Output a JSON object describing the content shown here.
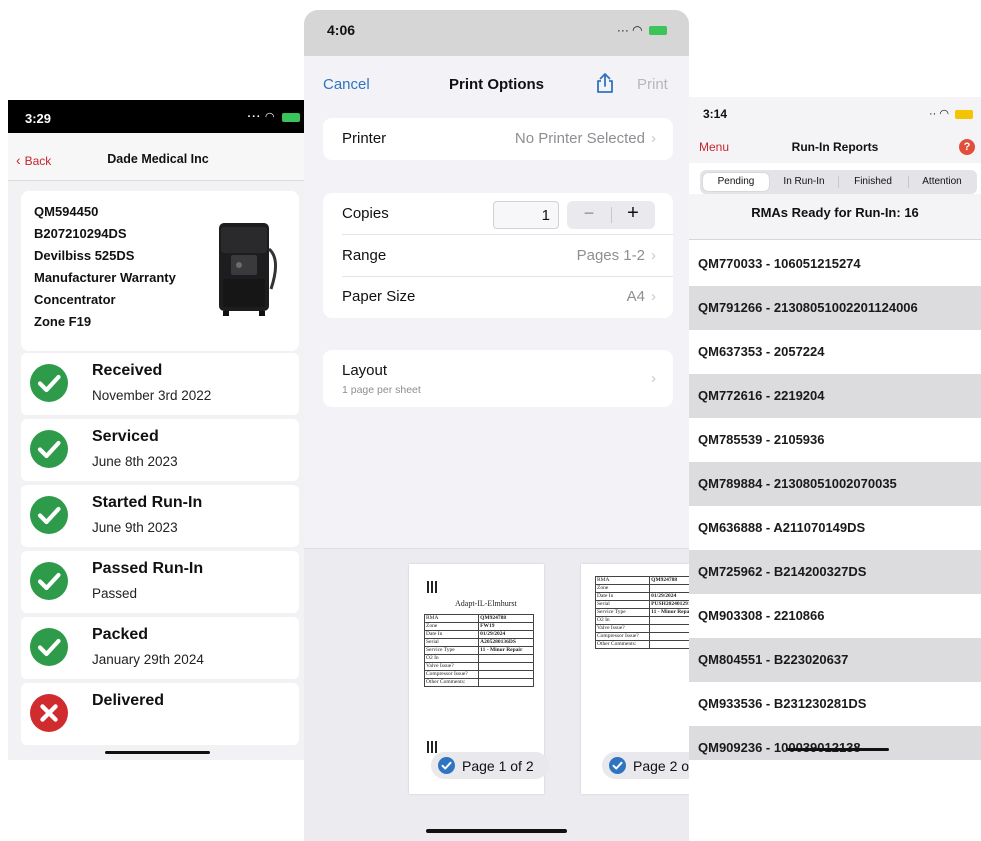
{
  "left": {
    "status_time": "3:29",
    "back_label": "Back",
    "title": "Dade Medical Inc",
    "info_lines": [
      "QM594450",
      "B207210294DS",
      "Devilbiss 525DS",
      "Manufacturer Warranty",
      "Concentrator",
      "Zone F19"
    ],
    "statuses": [
      {
        "label": "Received",
        "sub": "November 3rd 2022",
        "state": "done"
      },
      {
        "label": "Serviced",
        "sub": "June 8th 2023",
        "state": "done"
      },
      {
        "label": "Started Run-In",
        "sub": "June 9th 2023",
        "state": "done"
      },
      {
        "label": "Passed Run-In",
        "sub": "Passed",
        "state": "done"
      },
      {
        "label": "Packed",
        "sub": "January 29th 2024",
        "state": "done"
      },
      {
        "label": "Delivered",
        "sub": "",
        "state": "failed"
      }
    ],
    "colors": {
      "accent": "#c4262e",
      "check_green": "#2e9b4a",
      "fail_red": "#d02b2f"
    }
  },
  "middle": {
    "status_time": "4:06",
    "cancel_label": "Cancel",
    "title": "Print Options",
    "print_label": "Print",
    "printer_label": "Printer",
    "printer_value": "No Printer Selected",
    "copies_label": "Copies",
    "copies_value": "1",
    "range_label": "Range",
    "range_value": "Pages 1-2",
    "paper_label": "Paper Size",
    "paper_value": "A4",
    "layout_label": "Layout",
    "layout_sub": "1 page per sheet",
    "page1_label": "Page 1 of 2",
    "page2_label": "Page 2 o",
    "doc": {
      "name": "Adapt-IL-Elmhurst",
      "rows1": [
        [
          "RMA",
          "QM924788"
        ],
        [
          "Zone",
          "FW19"
        ],
        [
          "Date In",
          "01/29/2024"
        ],
        [
          "Serial",
          "A205280136DS"
        ],
        [
          "Service Type",
          "11 - Minor Repair"
        ],
        [
          "O2 In",
          ""
        ],
        [
          "Valve Issue?",
          ""
        ],
        [
          "Compressor Issue?",
          ""
        ],
        [
          "Other Comments:",
          ""
        ]
      ],
      "rows2": [
        [
          "RMA",
          "QM924788"
        ],
        [
          "Zone",
          ""
        ],
        [
          "Date In",
          "01/29/2024"
        ],
        [
          "Serial",
          "PUSH2024012910"
        ],
        [
          "Service Type",
          "11 - Minor Repair"
        ],
        [
          "O2 In",
          ""
        ],
        [
          "Valve Issue?",
          ""
        ],
        [
          "Compressor Issue?",
          ""
        ],
        [
          "Other Comments:",
          ""
        ]
      ]
    }
  },
  "right": {
    "status_time": "3:14",
    "menu_label": "Menu",
    "title": "Run-In Reports",
    "help_label": "?",
    "tabs": [
      "Pending",
      "In Run-In",
      "Finished",
      "Attention"
    ],
    "ready_text": "RMAs Ready for Run-In: 16",
    "rmas": [
      "QM770033 - 106051215274",
      "QM791266 - 21308051002201124006",
      "QM637353 - 2057224",
      "QM772616 - 2219204",
      "QM785539 - 2105936",
      "QM789884 - 21308051002070035",
      "QM636888 - A211070149DS",
      "QM725962 - B214200327DS",
      "QM903308 - 2210866",
      "QM804551 - B223020637",
      "QM933536 - B231230281DS",
      "QM909236 - 100039012138"
    ]
  }
}
